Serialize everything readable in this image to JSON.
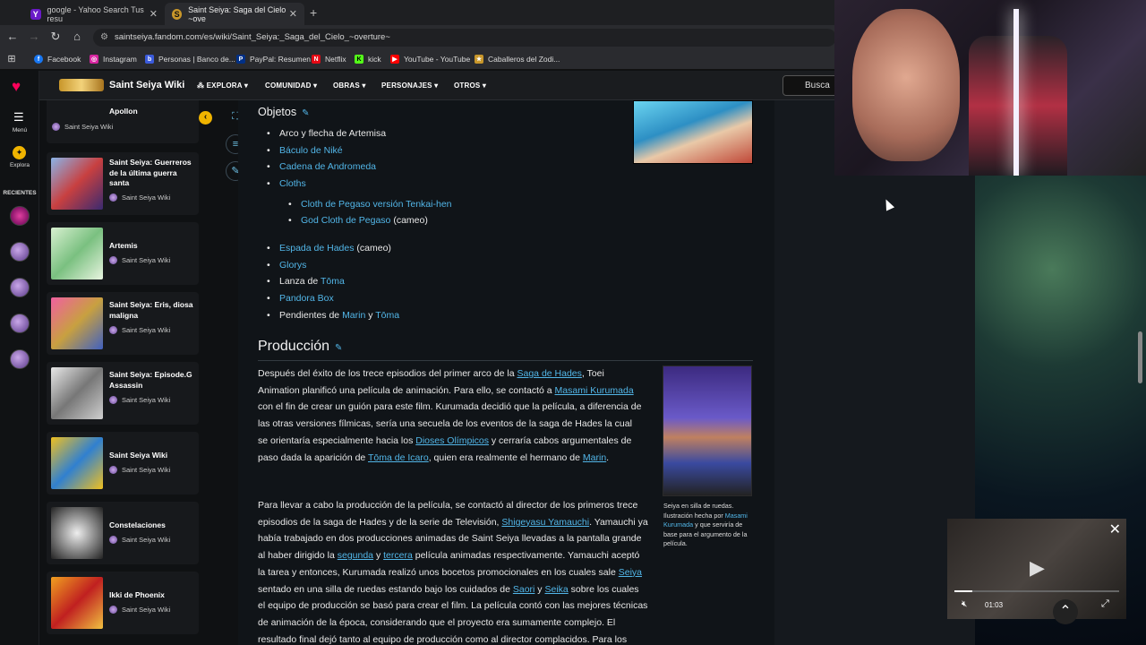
{
  "browser": {
    "tabs": [
      {
        "title": "google - Yahoo Search Tus resu"
      },
      {
        "title": "Saint Seiya: Saga del Cielo ~ove"
      }
    ],
    "url": "saintseiya.fandom.com/es/wiki/Saint_Seiya:_Saga_del_Cielo_~overture~",
    "bookmarks": [
      "Facebook",
      "Instagram",
      "Personas | Banco de...",
      "PayPal: Resumen",
      "Netflix",
      "kick",
      "YouTube - YouTube",
      "Caballeros del Zodi..."
    ]
  },
  "rail": {
    "menu": "Menú",
    "explore": "Explora",
    "recent": "RECIENTES"
  },
  "wiki": {
    "name": "Saint Seiya Wiki",
    "nav": [
      "EXPLORA",
      "COMUNIDAD",
      "OBRAS",
      "PERSONAJES",
      "OTROS"
    ],
    "search_label": "Busca"
  },
  "recent_list": {
    "partial_title": "Apollon",
    "partial_source": "Saint Seiya Wiki",
    "items": [
      {
        "title": "Saint Seiya: Guerreros de la última guerra santa",
        "source": "Saint Seiya Wiki"
      },
      {
        "title": "Artemis",
        "source": "Saint Seiya Wiki"
      },
      {
        "title": "Saint Seiya: Eris, diosa maligna",
        "source": "Saint Seiya Wiki"
      },
      {
        "title": "Saint Seiya: Episode.G Assassin",
        "source": "Saint Seiya Wiki"
      },
      {
        "title": "Saint Seiya Wiki",
        "source": "Saint Seiya Wiki"
      },
      {
        "title": "Constelaciones",
        "source": "Saint Seiya Wiki"
      },
      {
        "title": "Ikki de Phoenix",
        "source": "Saint Seiya Wiki"
      }
    ]
  },
  "article": {
    "objects_heading": "Objetos",
    "objects": {
      "item1": "Arco y flecha de Artemisa",
      "item2_link": "Báculo de Niké",
      "item3_link": "Cadena de Andromeda",
      "item4_link": "Cloths",
      "sub1_link": "Cloth de Pegaso versión Tenkai-hen",
      "sub2_link": "God Cloth de Pegaso",
      "sub2_text": " (cameo)",
      "item5_link": "Espada de Hades",
      "item5_text": " (cameo)",
      "item6_link": "Glorys",
      "item7_text": "Lanza de ",
      "item7_link": "Tōma",
      "item8_link": "Pandora Box",
      "item9_text1": "Pendientes de ",
      "item9_link1": "Marin",
      "item9_text2": " y ",
      "item9_link2": "Tōma"
    },
    "production_heading": "Producción",
    "p1": {
      "t1": "Después del éxito de los trece episodios del primer arco de la ",
      "l1": "Saga de Hades",
      "t2": ", Toei Animation planificó una película de animación. Para ello, se contactó a ",
      "l2": "Masami Kurumada",
      "t3": " con el fin de crear un guión para este film. Kurumada decidió que la película, a diferencia de las otras versiones fílmicas, sería una secuela de los eventos de la saga de Hades la cual se orientaría especialmente hacia los ",
      "l3": "Dioses Olímpicos",
      "t4": " y cerraría cabos argumentales de paso dada la aparición de ",
      "l4": "Tōma de Icaro",
      "t5": ", quien era realmente el hermano de ",
      "l5": "Marin",
      "t6": "."
    },
    "p2": {
      "t1": "Para llevar a cabo la producción de la película, se contactó al director de los primeros trece episodios de la saga de Hades y de la serie de Televisión, ",
      "l1": "Shigeyasu Yamauchi",
      "t2": ". Yamauchi ya había trabajado en dos producciones animadas de Saint Seiya llevadas a la pantalla grande al haber dirigido la ",
      "l2": "segunda",
      "t3": " y ",
      "l3": "tercera",
      "t4": " película animadas respectivamente. Yamauchi aceptó la tarea y entonces, Kurumada realizó unos bocetos promocionales en los cuales sale ",
      "l4": "Seiya",
      "t5": " sentado en una silla de ruedas estando bajo los cuidados de ",
      "l5": "Saori",
      "t6": " y ",
      "l6": "Seika",
      "t7": " sobre los cuales el equipo de producción se basó para crear el film. La película contó con las mejores técnicas de animación de la época, considerando que el proyecto era sumamente complejo. El resultado final dejó tanto al equipo de producción como al director complacidos. Para los diseños de personajes y la dirección de animación, se volvió"
    },
    "caption": {
      "t1": "Seiya en silla de ruedas. Ilustración hecha por ",
      "l1": "Masami Kurumada",
      "t2": " y que serviría de base para el argumento de la película."
    }
  },
  "video": {
    "time": "01:03",
    "progress": 0.11
  }
}
